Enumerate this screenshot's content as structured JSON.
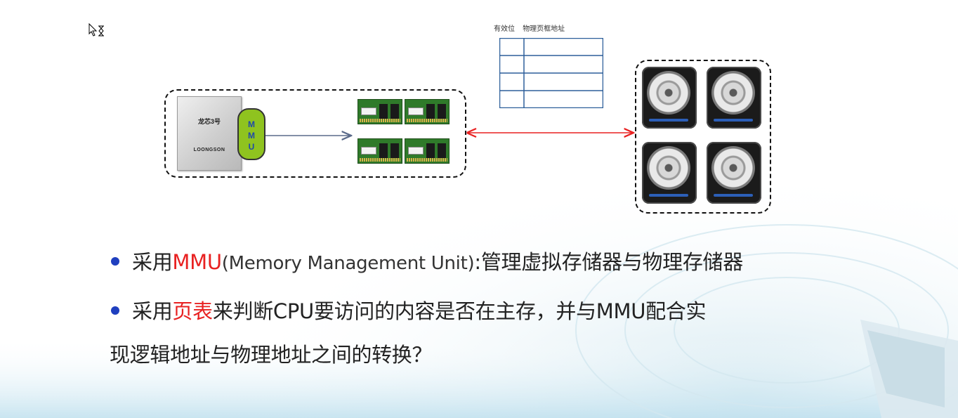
{
  "colors": {
    "accent_red": "#e82121",
    "bullet_blue": "#1f3fbf",
    "mmu_green": "#8fc31f",
    "table_blue": "#2d5f9a"
  },
  "diagram": {
    "page_table_headers": [
      "有效位",
      "物理页框地址"
    ],
    "page_table_rows": 4,
    "cpu_chip": {
      "name": "龙芯3号",
      "brand": "LOONGSON"
    },
    "mmu_letters": [
      "M",
      "M",
      "U"
    ],
    "ram_modules": 4,
    "hard_disks": 4,
    "icons": [
      "cursor-hourglass-icon",
      "cpu-chip-icon",
      "ram-module-icon",
      "hard-disk-icon"
    ]
  },
  "bullets": [
    {
      "prefix": "采用",
      "highlight": "MMU",
      "paren": "(Memory Management Unit)",
      "suffix": ":管理虚拟存储器与物理存储器"
    },
    {
      "prefix": "采用",
      "highlight": "页表",
      "suffix": "来判断CPU要访问的内容是否在主存，并与MMU配合实",
      "continuation": "现逻辑地址与物理地址之间的转换？"
    }
  ]
}
